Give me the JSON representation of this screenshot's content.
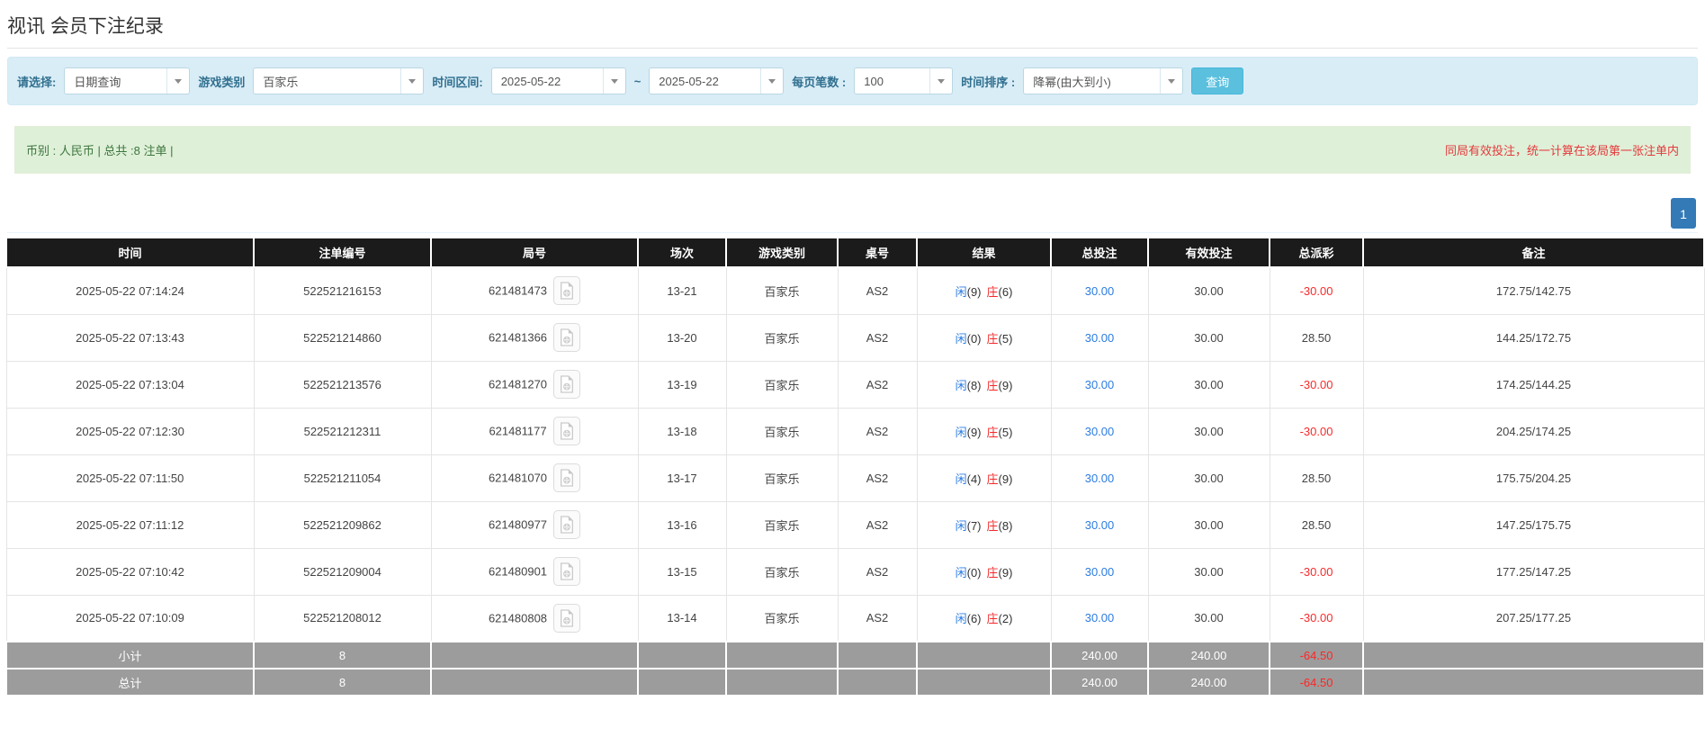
{
  "page": {
    "title": "视讯 会员下注纪录"
  },
  "filter": {
    "select_label": "请选择:",
    "select_value": "日期查询",
    "game_label": "游戏类别",
    "game_value": "百家乐",
    "range_label": "时间区间:",
    "date_from": "2025-05-22",
    "range_separator": "~",
    "date_to": "2025-05-22",
    "page_size_label": "每页笔数 :",
    "page_size_value": "100",
    "sort_label": "时间排序 :",
    "sort_value": "降幂(由大到小)",
    "search_button": "查询"
  },
  "info_bar": {
    "summary": "币别 : 人民币 | 总共 :8 注单 |",
    "notice": "同局有效投注，统一计算在该局第一张注单内"
  },
  "pagination": {
    "pages": [
      "1"
    ]
  },
  "icons": {
    "round_cell_icon": "video-file-icon",
    "select_caret": "chevron-down-icon"
  },
  "colors": {
    "filter_bg": "#d9edf7",
    "filter_label": "#31708f",
    "search_button": "#5bc0de",
    "info_bg": "#dff0d8",
    "info_text": "#3c763d",
    "notice_red": "#e4393c",
    "header_bg": "#1b1b1b",
    "summary_bg": "#9c9c9c",
    "bet_blue": "#2b7ce0",
    "loss_red": "#f52b2b",
    "active_page": "#337ab7"
  },
  "table": {
    "columns": [
      "时间",
      "注单编号",
      "局号",
      "场次",
      "游戏类别",
      "桌号",
      "结果",
      "总投注",
      "有效投注",
      "总派彩",
      "备注"
    ],
    "rows": [
      {
        "time": "2025-05-22 07:14:24",
        "bet_no": "522521216153",
        "round": "621481473",
        "session": "13-21",
        "game": "百家乐",
        "table_no": "AS2",
        "player": "闲",
        "player_pts": "(9)",
        "banker": "庄",
        "banker_pts": "(6)",
        "total_bet": "30.00",
        "valid_bet": "30.00",
        "payout": "-30.00",
        "payout_cls": "neg",
        "note": "172.75/142.75"
      },
      {
        "time": "2025-05-22 07:13:43",
        "bet_no": "522521214860",
        "round": "621481366",
        "session": "13-20",
        "game": "百家乐",
        "table_no": "AS2",
        "player": "闲",
        "player_pts": "(0)",
        "banker": "庄",
        "banker_pts": "(5)",
        "total_bet": "30.00",
        "valid_bet": "30.00",
        "payout": "28.50",
        "payout_cls": "plain",
        "note": "144.25/172.75"
      },
      {
        "time": "2025-05-22 07:13:04",
        "bet_no": "522521213576",
        "round": "621481270",
        "session": "13-19",
        "game": "百家乐",
        "table_no": "AS2",
        "player": "闲",
        "player_pts": "(8)",
        "banker": "庄",
        "banker_pts": "(9)",
        "total_bet": "30.00",
        "valid_bet": "30.00",
        "payout": "-30.00",
        "payout_cls": "neg",
        "note": "174.25/144.25"
      },
      {
        "time": "2025-05-22 07:12:30",
        "bet_no": "522521212311",
        "round": "621481177",
        "session": "13-18",
        "game": "百家乐",
        "table_no": "AS2",
        "player": "闲",
        "player_pts": "(9)",
        "banker": "庄",
        "banker_pts": "(5)",
        "total_bet": "30.00",
        "valid_bet": "30.00",
        "payout": "-30.00",
        "payout_cls": "neg",
        "note": "204.25/174.25"
      },
      {
        "time": "2025-05-22 07:11:50",
        "bet_no": "522521211054",
        "round": "621481070",
        "session": "13-17",
        "game": "百家乐",
        "table_no": "AS2",
        "player": "闲",
        "player_pts": "(4)",
        "banker": "庄",
        "banker_pts": "(9)",
        "total_bet": "30.00",
        "valid_bet": "30.00",
        "payout": "28.50",
        "payout_cls": "plain",
        "note": "175.75/204.25"
      },
      {
        "time": "2025-05-22 07:11:12",
        "bet_no": "522521209862",
        "round": "621480977",
        "session": "13-16",
        "game": "百家乐",
        "table_no": "AS2",
        "player": "闲",
        "player_pts": "(7)",
        "banker": "庄",
        "banker_pts": "(8)",
        "total_bet": "30.00",
        "valid_bet": "30.00",
        "payout": "28.50",
        "payout_cls": "plain",
        "note": "147.25/175.75"
      },
      {
        "time": "2025-05-22 07:10:42",
        "bet_no": "522521209004",
        "round": "621480901",
        "session": "13-15",
        "game": "百家乐",
        "table_no": "AS2",
        "player": "闲",
        "player_pts": "(0)",
        "banker": "庄",
        "banker_pts": "(9)",
        "total_bet": "30.00",
        "valid_bet": "30.00",
        "payout": "-30.00",
        "payout_cls": "neg",
        "note": "177.25/147.25"
      },
      {
        "time": "2025-05-22 07:10:09",
        "bet_no": "522521208012",
        "round": "621480808",
        "session": "13-14",
        "game": "百家乐",
        "table_no": "AS2",
        "player": "闲",
        "player_pts": "(6)",
        "banker": "庄",
        "banker_pts": "(2)",
        "total_bet": "30.00",
        "valid_bet": "30.00",
        "payout": "-30.00",
        "payout_cls": "neg",
        "note": "207.25/177.25"
      }
    ],
    "subtotal": {
      "label": "小计",
      "count": "8",
      "total_bet": "240.00",
      "valid_bet": "240.00",
      "payout": "-64.50",
      "payout_cls": "sneg"
    },
    "grandtotal": {
      "label": "总计",
      "count": "8",
      "total_bet": "240.00",
      "valid_bet": "240.00",
      "payout": "-64.50",
      "payout_cls": "sneg"
    }
  }
}
